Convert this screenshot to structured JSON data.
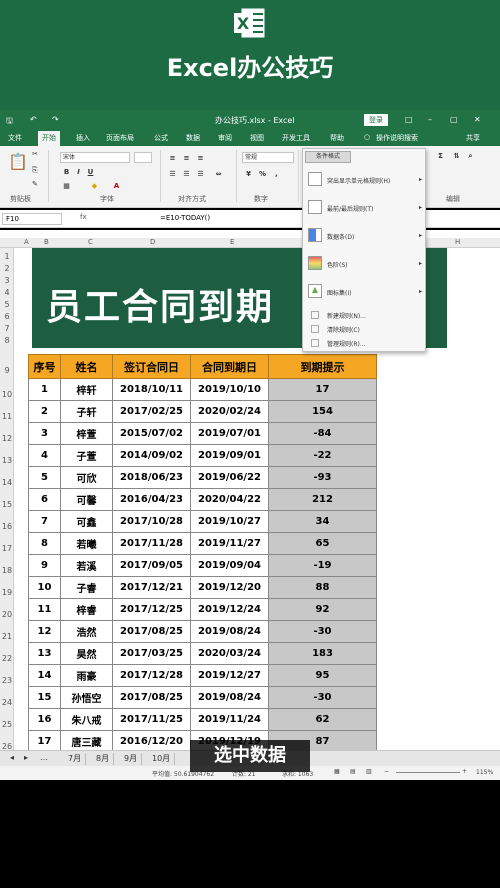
{
  "banner": {
    "title": "Excel办公技巧",
    "logo_letter": "X"
  },
  "window": {
    "title": "办公技巧.xlsx - Excel",
    "login": "登录"
  },
  "menu": [
    "文件",
    "开始",
    "插入",
    "页面布局",
    "公式",
    "数据",
    "审阅",
    "视图",
    "开发工具",
    "帮助",
    "操作说明搜索",
    "共享"
  ],
  "ribbon": {
    "font_name": "宋体",
    "number_format": "常规",
    "groups": [
      "剪贴板",
      "字体",
      "对齐方式",
      "数字",
      "编辑"
    ],
    "cond_format": "条件格式",
    "insert": "插入"
  },
  "formula": {
    "cell": "F10",
    "fx": "fx",
    "value": "=E10-TODAY()"
  },
  "columns": [
    "A",
    "B",
    "C",
    "D",
    "E",
    "F",
    "G",
    "H"
  ],
  "rows": [
    "1",
    "2",
    "3",
    "4",
    "5",
    "6",
    "7",
    "8",
    "9",
    "10",
    "11",
    "12",
    "13",
    "14",
    "15",
    "16",
    "17",
    "18",
    "19",
    "20",
    "21",
    "22",
    "23",
    "24",
    "25",
    "26"
  ],
  "sheet_title": "员工合同到期",
  "table": {
    "headers": [
      "序号",
      "姓名",
      "签订合同日",
      "合同到期日",
      "到期提示"
    ],
    "rows": [
      [
        "1",
        "梓轩",
        "2018/10/11",
        "2019/10/10",
        "17"
      ],
      [
        "2",
        "子轩",
        "2017/02/25",
        "2020/02/24",
        "154"
      ],
      [
        "3",
        "梓萱",
        "2015/07/02",
        "2019/07/01",
        "-84"
      ],
      [
        "4",
        "子萱",
        "2014/09/02",
        "2019/09/01",
        "-22"
      ],
      [
        "5",
        "可欣",
        "2018/06/23",
        "2019/06/22",
        "-93"
      ],
      [
        "6",
        "可馨",
        "2016/04/23",
        "2020/04/22",
        "212"
      ],
      [
        "7",
        "可鑫",
        "2017/10/28",
        "2019/10/27",
        "34"
      ],
      [
        "8",
        "若曦",
        "2017/11/28",
        "2019/11/27",
        "65"
      ],
      [
        "9",
        "若溪",
        "2017/09/05",
        "2019/09/04",
        "-19"
      ],
      [
        "10",
        "子睿",
        "2017/12/21",
        "2019/12/20",
        "88"
      ],
      [
        "11",
        "梓睿",
        "2017/12/25",
        "2019/12/24",
        "92"
      ],
      [
        "12",
        "浩然",
        "2017/08/25",
        "2019/08/24",
        "-30"
      ],
      [
        "13",
        "昊然",
        "2017/03/25",
        "2020/03/24",
        "183"
      ],
      [
        "14",
        "雨豪",
        "2017/12/28",
        "2019/12/27",
        "95"
      ],
      [
        "15",
        "孙悟空",
        "2017/08/25",
        "2019/08/24",
        "-30"
      ],
      [
        "16",
        "朱八戒",
        "2017/11/25",
        "2019/11/24",
        "62"
      ],
      [
        "17",
        "唐三藏",
        "2016/12/20",
        "2019/12/19",
        "87"
      ]
    ]
  },
  "cf_menu": {
    "items": [
      "突出显示单元格规则(H)",
      "最前/最后规则(T)",
      "数据条(D)",
      "色阶(S)",
      "图标集(I)"
    ],
    "small": [
      "新建规则(N)...",
      "清除规则(C)",
      "管理规则(R)..."
    ]
  },
  "sheets": [
    "7月",
    "8月",
    "9月",
    "10月"
  ],
  "status": {
    "avg": "平均值: 50.61904762",
    "count": "计数: 21",
    "sum": "求和: 1063",
    "zoom": "115%"
  },
  "caption": "选中数据"
}
